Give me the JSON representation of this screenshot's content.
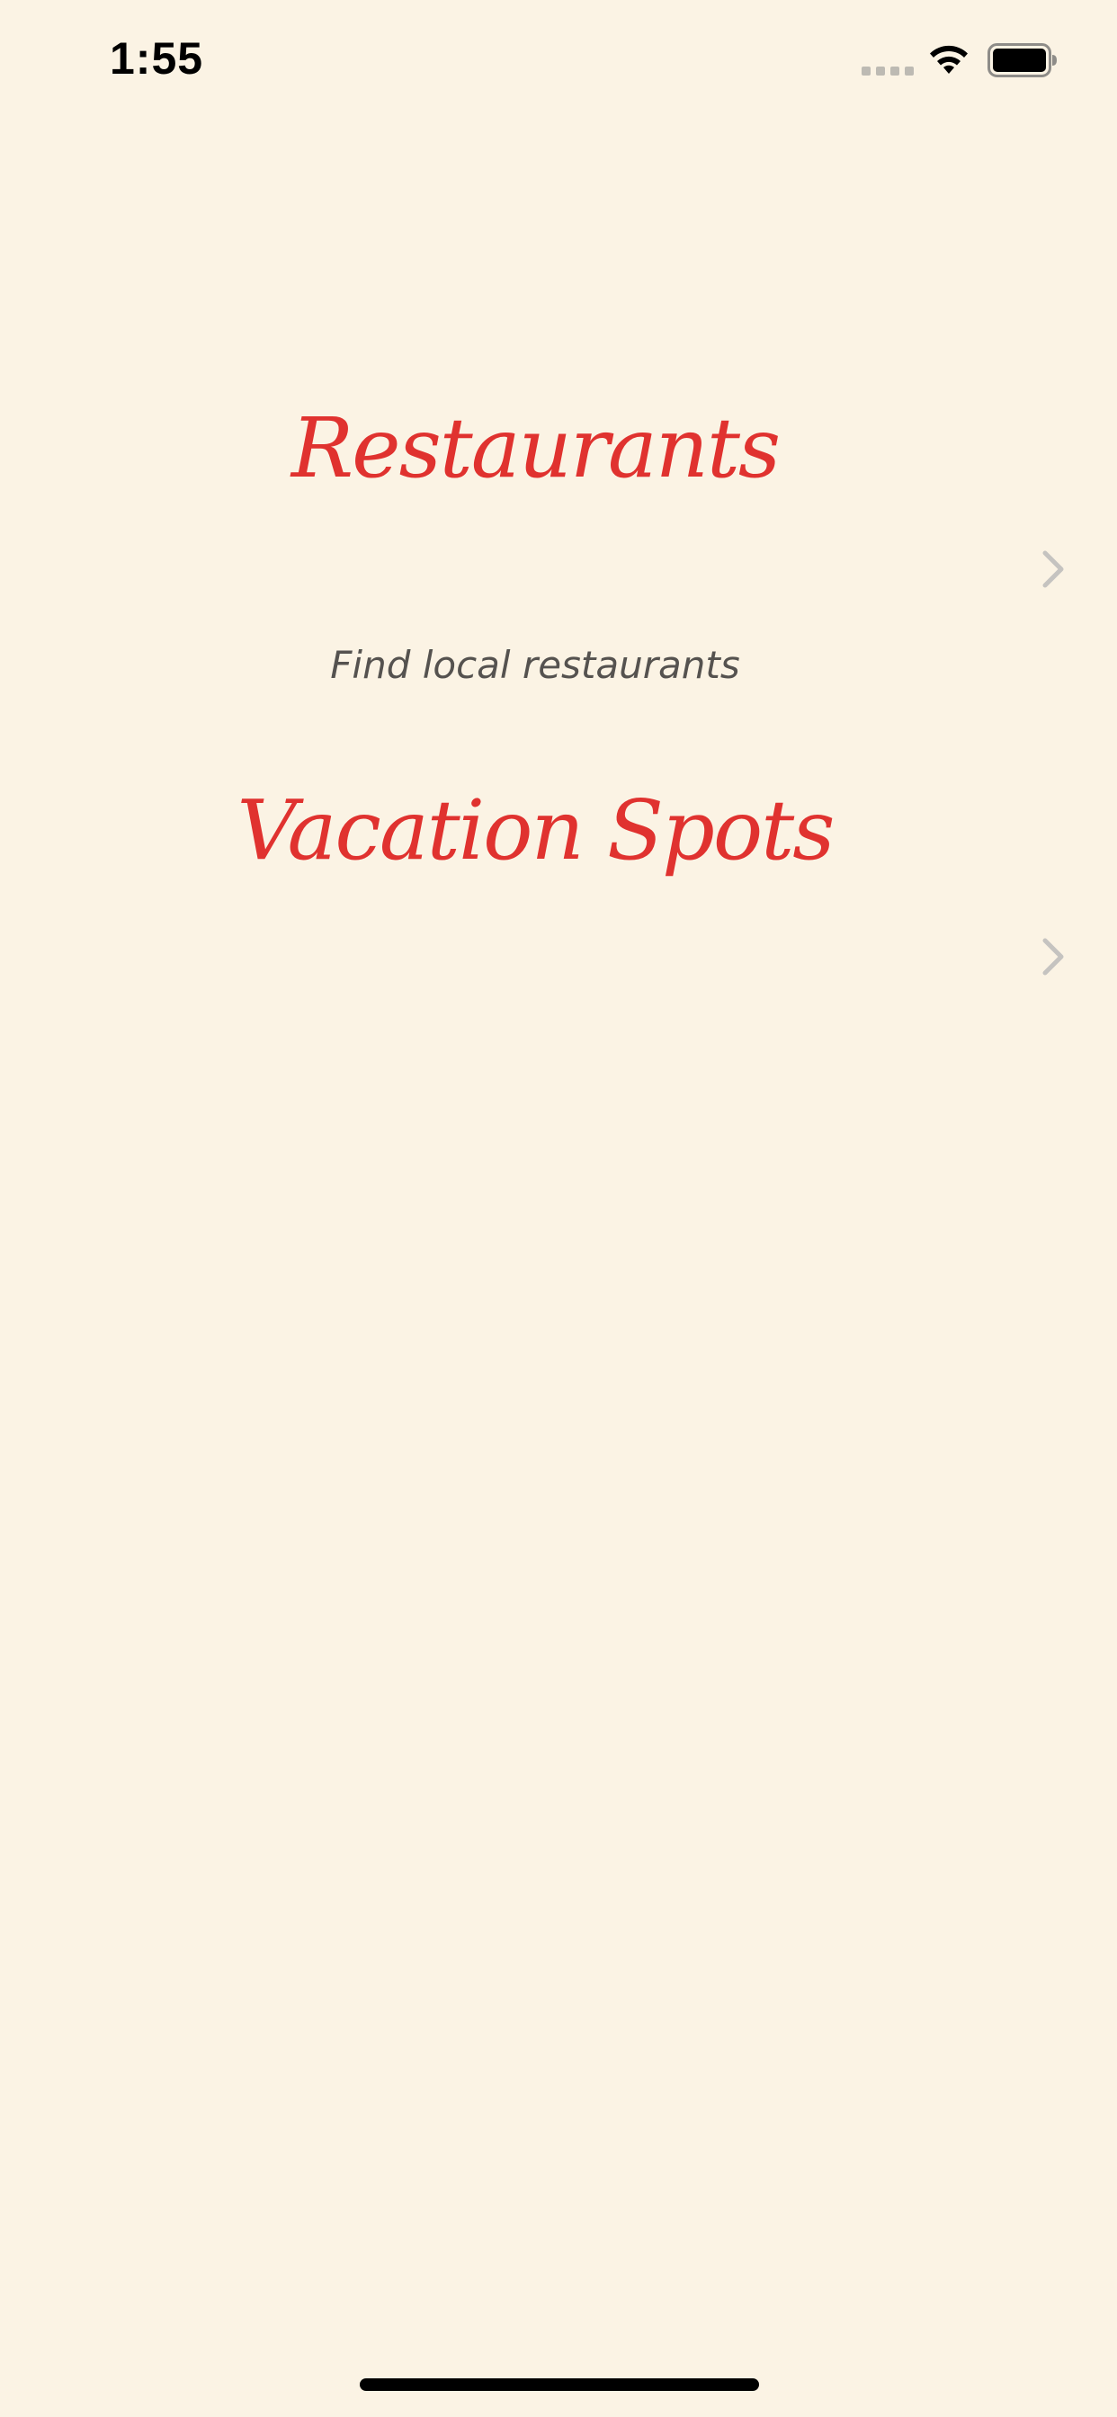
{
  "status_bar": {
    "time": "1:55",
    "icons": [
      "cellular-signal-icon",
      "wifi-icon",
      "battery-icon"
    ]
  },
  "list": {
    "items": [
      {
        "title": "Restaurants",
        "subtitle": "Find local restaurants",
        "accessory": "chevron-right-icon"
      },
      {
        "title": "Vacation Spots",
        "subtitle": "",
        "accessory": "chevron-right-icon"
      }
    ]
  },
  "colors": {
    "background": "#fbf3e4",
    "title": "#e0322f",
    "subtitle": "#55524f",
    "chevron": "#c5c3c0"
  }
}
